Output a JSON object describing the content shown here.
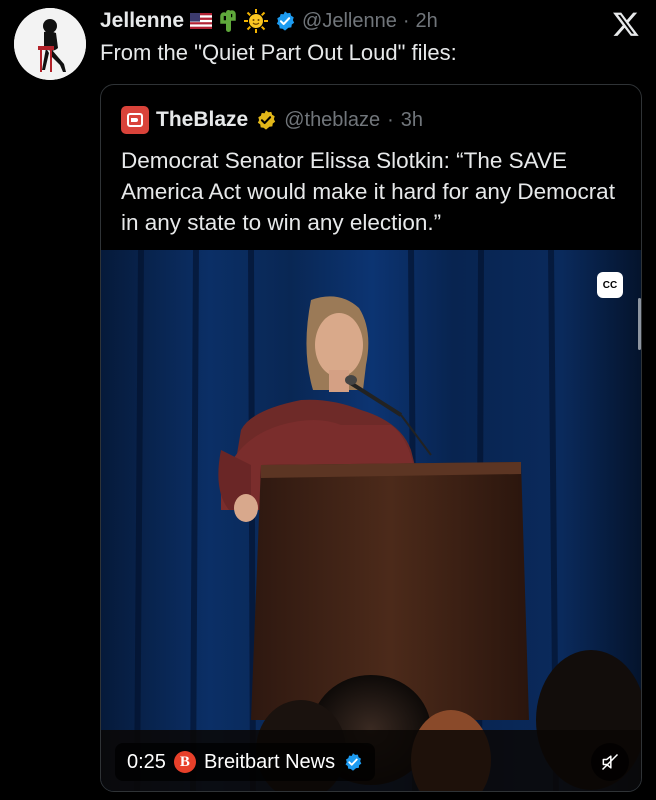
{
  "post": {
    "display_name": "Jellenne",
    "handle": "@Jellenne",
    "separator": "·",
    "time": "2h",
    "text": "From the \"Quiet Part Out Loud\" files:",
    "emoji_icons": [
      "us-flag-icon",
      "cactus-icon",
      "sun-face-icon"
    ],
    "verified_color": "#1d9bf0"
  },
  "quoted": {
    "display_name": "TheBlaze",
    "handle": "@theblaze",
    "separator": "·",
    "time": "3h",
    "text": "Democrat Senator Elissa Slotkin: “The SAVE America Act would make it hard for any Democrat in any state to win any election.”",
    "verified_color": "#e2b719",
    "logo_color": "#d9433a"
  },
  "video": {
    "duration": "0:25",
    "source": "Breitbart News",
    "source_logo_letter": "B",
    "cc_label": "CC",
    "source_logo_color": "#e8402a"
  },
  "colors": {
    "background": "#000000",
    "text_primary": "#e7e9ea",
    "text_secondary": "#71767b",
    "border": "#2f3336"
  }
}
